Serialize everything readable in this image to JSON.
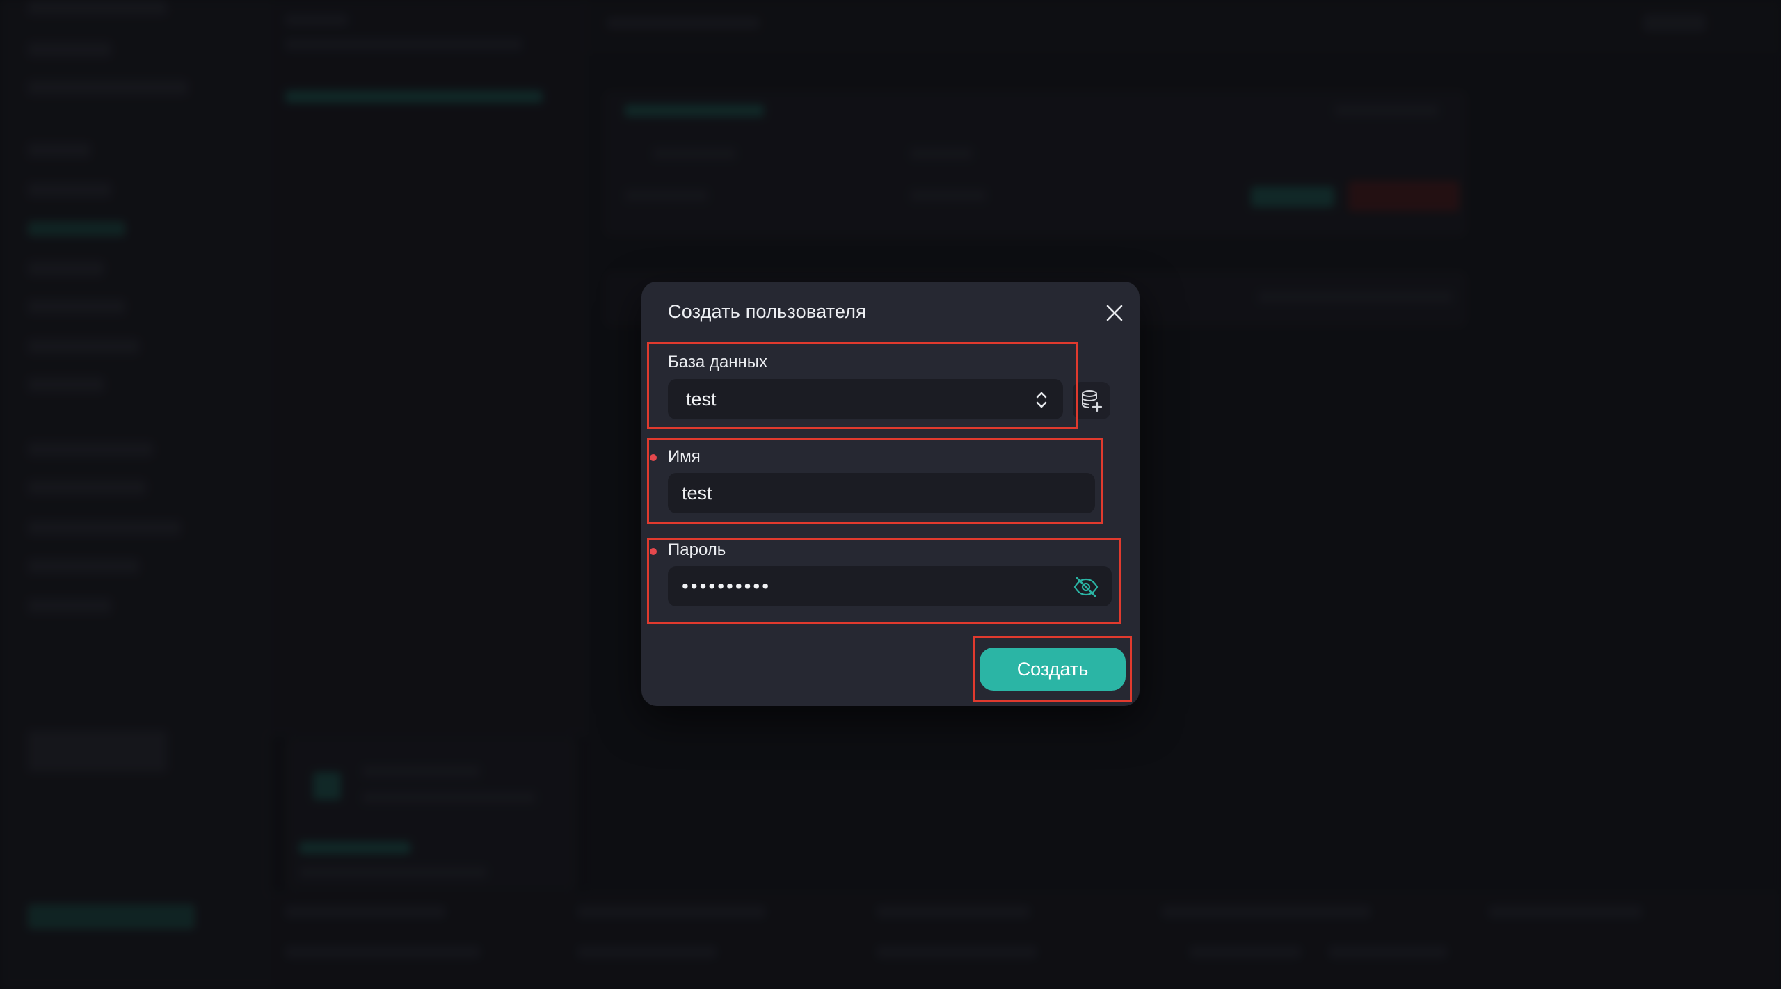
{
  "modal": {
    "title": "Создать пользователя",
    "close_icon": "close-icon",
    "database": {
      "label": "База данных",
      "value": "test",
      "select_icon": "chevron-updown-icon",
      "add_icon": "database-add-icon"
    },
    "name": {
      "label": "Имя",
      "value": "test",
      "required": true
    },
    "password": {
      "label": "Пароль",
      "masked_value": "••••••••••",
      "required": true,
      "toggle_icon": "eye-off-icon"
    },
    "submit_label": "Создать"
  },
  "colors": {
    "accent": "#2bb5a5",
    "required": "#e5484d",
    "highlight": "#e03a2e",
    "modal_bg": "#262832"
  }
}
